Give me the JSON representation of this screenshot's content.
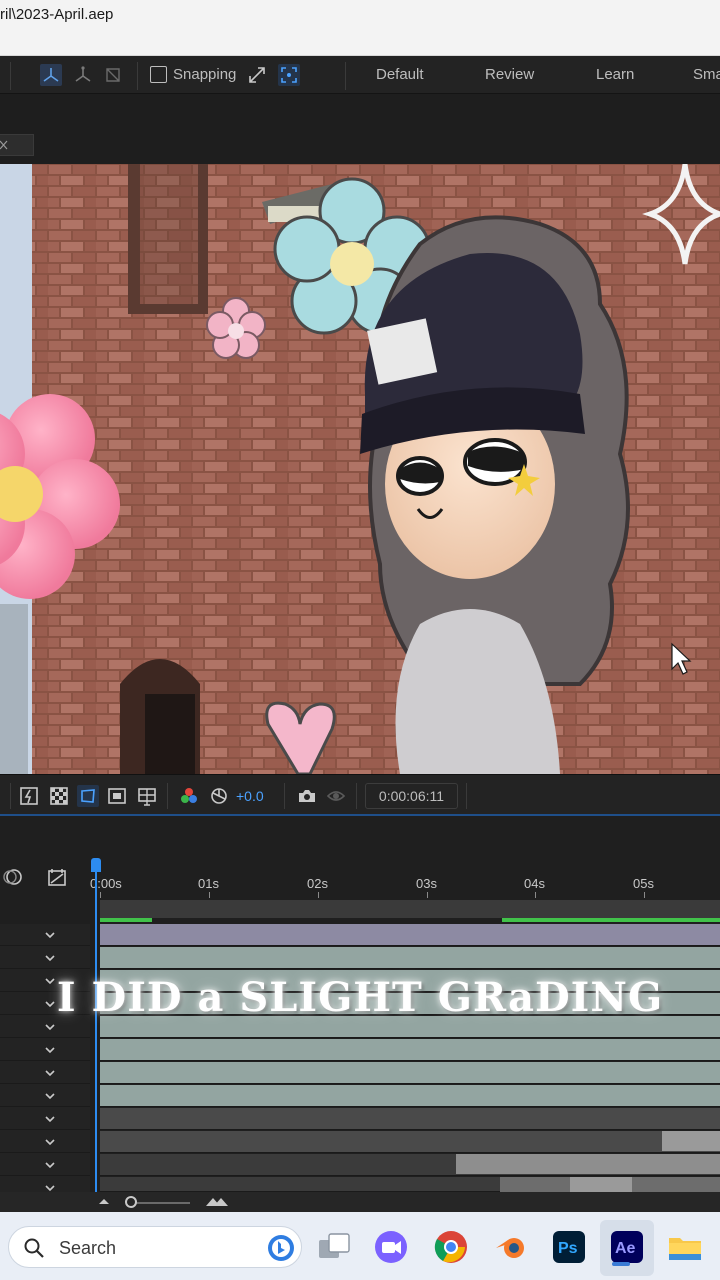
{
  "window": {
    "title": "ril\\2023-April.aep"
  },
  "toolbar": {
    "snapping_label": "Snapping",
    "workspaces": [
      "Default",
      "Review",
      "Learn",
      "Sma"
    ]
  },
  "viewer_controls": {
    "exposure": "+0.0",
    "timecode": "0:00:06:11"
  },
  "timeline": {
    "ruler_labels": [
      "0:00s",
      "01s",
      "02s",
      "03s",
      "04s",
      "05s"
    ]
  },
  "overlay_caption": "I DID a SLIGHT GRaDING",
  "taskbar": {
    "search_label": "Search",
    "apps": [
      "video-call",
      "chrome",
      "blender",
      "Ps",
      "Ae",
      "file-explorer"
    ],
    "active_app": "Ae"
  },
  "colors": {
    "accent_blue": "#2d8cf0",
    "green_work_area": "#41c24a",
    "track_fill": "#93a5a1"
  }
}
